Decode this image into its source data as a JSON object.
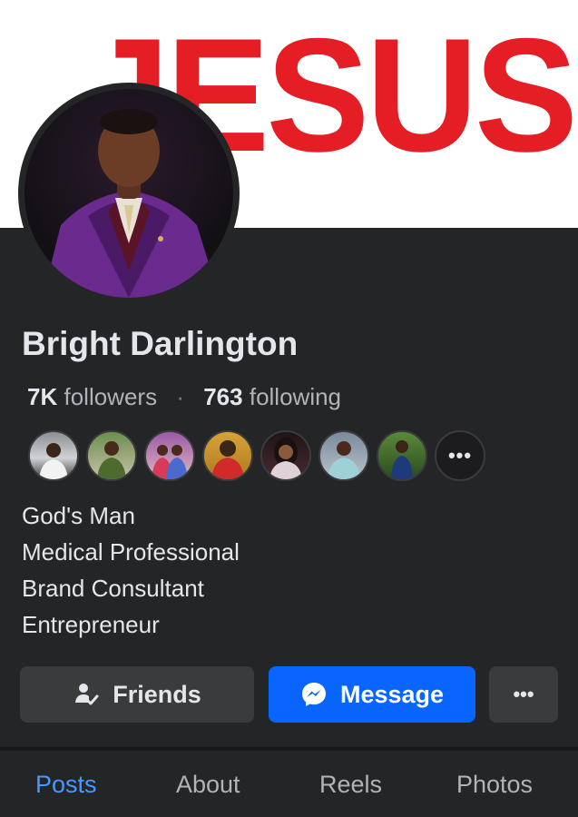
{
  "cover": {
    "text": "JESUS",
    "color": "#e41e24"
  },
  "profile": {
    "name": "Bright Darlington",
    "followers_count": "7K",
    "followers_label": "followers",
    "separator": "·",
    "following_count": "763",
    "following_label": "following"
  },
  "mutual_friends": {
    "avatars": [
      "friend-1",
      "friend-2",
      "friend-3",
      "friend-4",
      "friend-5",
      "friend-6",
      "friend-7"
    ],
    "more_label": "•••"
  },
  "bio": [
    "God's Man",
    "Medical Professional",
    "Brand Consultant",
    "Entrepreneur"
  ],
  "actions": {
    "friends_label": "Friends",
    "message_label": "Message",
    "more_label": "•••"
  },
  "tabs": [
    {
      "label": "Posts",
      "active": true
    },
    {
      "label": "About",
      "active": false
    },
    {
      "label": "Reels",
      "active": false
    },
    {
      "label": "Photos",
      "active": false
    }
  ],
  "colors": {
    "background": "#242526",
    "accent_blue": "#0866ff",
    "active_tab": "#4599ff",
    "secondary_text": "#b0b3b8"
  },
  "icons": [
    "user-check-icon",
    "messenger-icon",
    "more-icon"
  ]
}
